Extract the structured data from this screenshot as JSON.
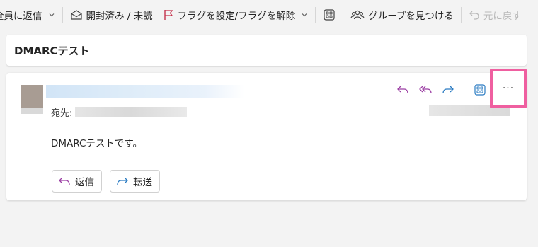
{
  "toolbar": {
    "reply_all_label": "全員に返信",
    "read_unread_label": "開封済み / 未読",
    "flag_label": "フラグを設定/フラグを解除",
    "find_groups_label": "グループを見つける",
    "undo_label": "元に戻す"
  },
  "subject": "DMARCテスト",
  "message": {
    "to_label": "宛先:",
    "body": "DMARCテストです。",
    "more_label": "···",
    "reply_button": "返信",
    "forward_button": "転送"
  },
  "colors": {
    "reply_icon": "#9b3da3",
    "forward_icon": "#2a7bc2",
    "flag_icon": "#c4314b",
    "highlight": "#ef5fa0"
  }
}
